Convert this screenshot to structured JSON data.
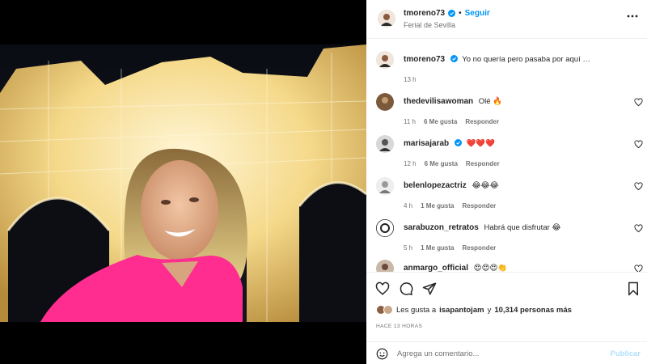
{
  "post": {
    "username": "tmoreno73",
    "follow_label": "Seguir",
    "separator": "•",
    "location": "Ferial de Sevilla",
    "caption": "Yo no quería pero pasaba por aquí …",
    "caption_time": "13 h"
  },
  "comments": [
    {
      "username": "thedevilisawoman",
      "text": "Olé 🔥",
      "time": "11 h",
      "likes": "6 Me gusta",
      "reply": "Responder",
      "verified": false
    },
    {
      "username": "marisajarab",
      "text": "❤️❤️❤️",
      "time": "12 h",
      "likes": "6 Me gusta",
      "reply": "Responder",
      "verified": true
    },
    {
      "username": "belenlopezactriz",
      "text": "😂😂😂",
      "time": "4 h",
      "likes": "1 Me gusta",
      "reply": "Responder",
      "verified": false
    },
    {
      "username": "sarabuzon_retratos",
      "text": "Habrá que disfrutar 😂",
      "time": "5 h",
      "likes": "1 Me gusta",
      "reply": "Responder",
      "verified": false
    },
    {
      "username": "anmargo_official",
      "text": "😍😍😍👏",
      "time": "",
      "likes": "",
      "reply": "",
      "verified": false
    }
  ],
  "likes": {
    "prefix": "Les gusta a",
    "user": "isapantojam",
    "connector": "y",
    "count": "10,314 personas más"
  },
  "time_ago": "HACE 13 HORAS",
  "composer": {
    "placeholder": "Agrega un comentario...",
    "publish_label": "Publicar"
  },
  "colors": {
    "accent": "#0095f6",
    "publish_disabled": "#b2dffc",
    "verified": "#0095f6"
  }
}
